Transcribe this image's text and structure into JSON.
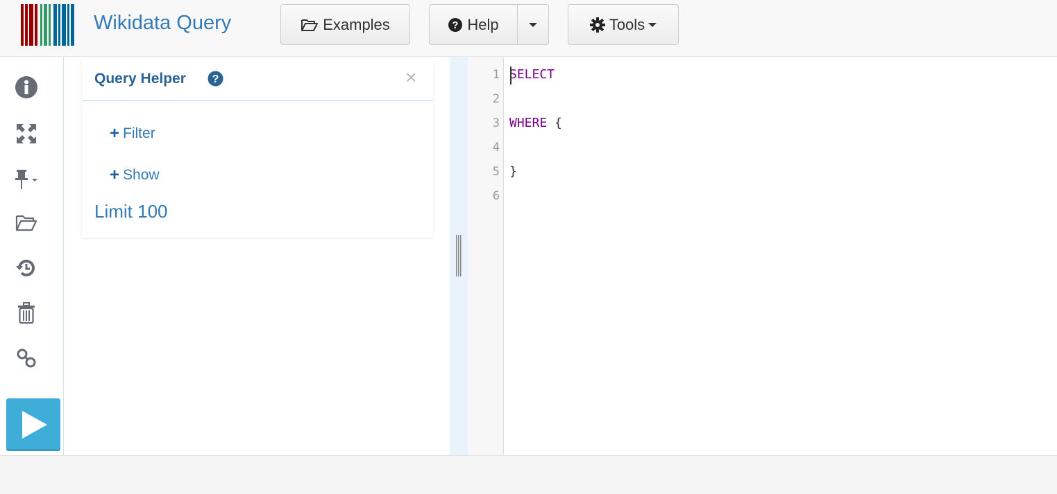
{
  "app": {
    "brand": "Wikidata Query"
  },
  "navbar": {
    "examples_label": "Examples",
    "help_label": "Help",
    "tools_label": "Tools"
  },
  "toolbar": {
    "icons": [
      "info-icon",
      "fullscreen-icon",
      "pin-icon",
      "folder-open-icon",
      "history-icon",
      "trash-icon",
      "link-icon",
      "play-icon"
    ]
  },
  "query_helper": {
    "title": "Query Helper",
    "close_symbol": "×",
    "filter_label": "Filter",
    "show_label": "Show",
    "limit_label": "Limit 100"
  },
  "editor": {
    "line_numbers": [
      "1",
      "2",
      "3",
      "4",
      "5",
      "6"
    ],
    "lines": {
      "l1": "SELECT",
      "l3_kw": "WHERE",
      "l3_brace": " {",
      "l5": "}"
    }
  },
  "colors": {
    "brand": "#337ab7",
    "keyword": "#770088",
    "run_button": "#3eaed8",
    "logo_red": "#990000",
    "logo_green": "#339966",
    "logo_blue": "#006699"
  }
}
